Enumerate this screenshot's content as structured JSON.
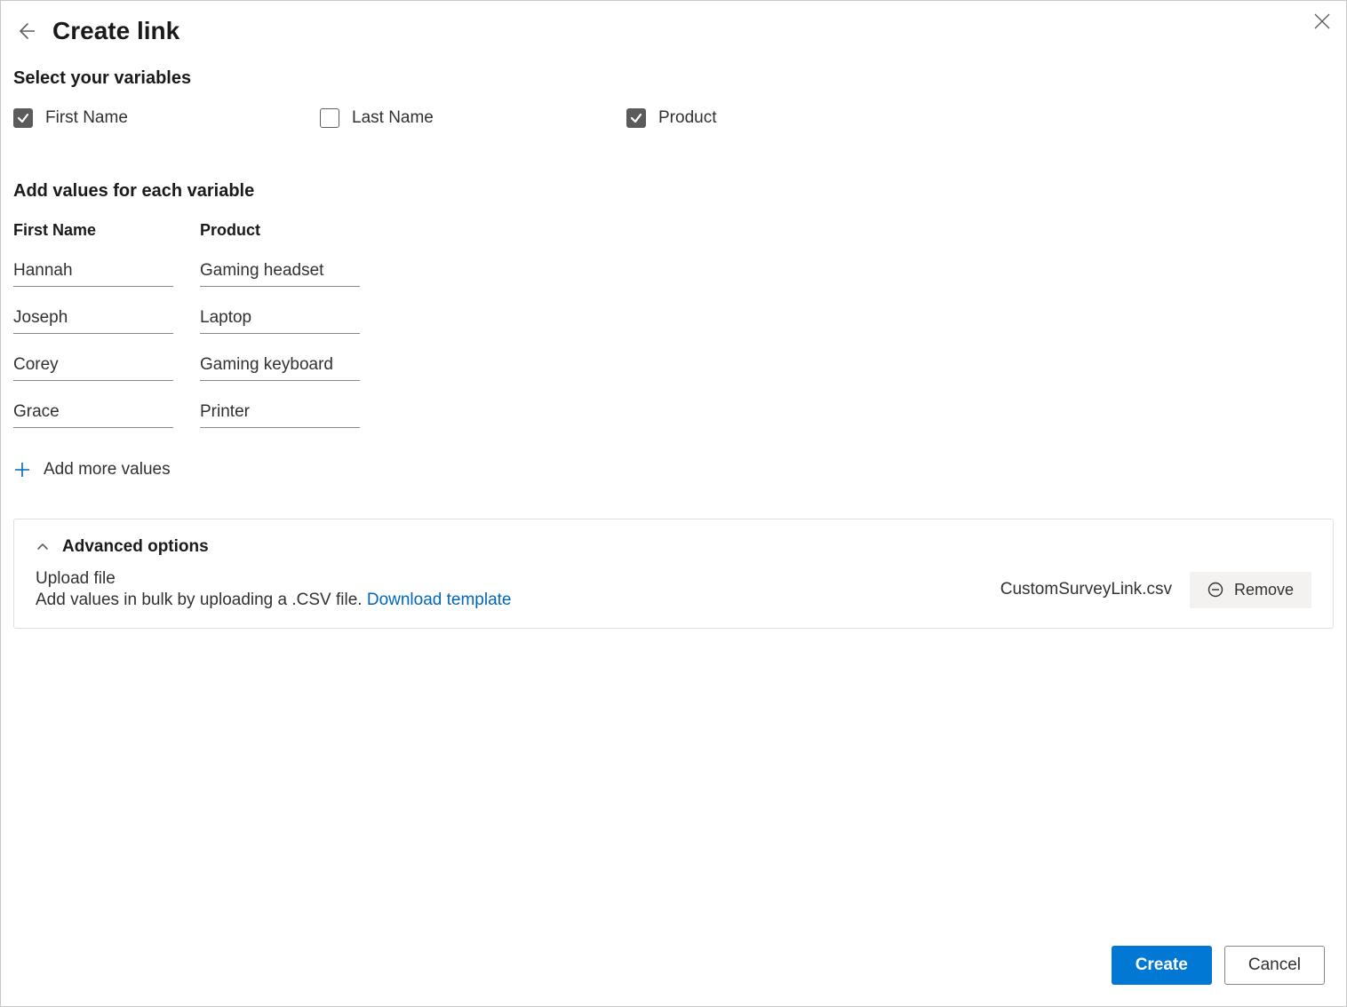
{
  "header": {
    "title": "Create link"
  },
  "sections": {
    "select_vars_heading": "Select your variables",
    "add_values_heading": "Add values for each variable"
  },
  "variables": [
    {
      "label": "First Name",
      "checked": true
    },
    {
      "label": "Last Name",
      "checked": false
    },
    {
      "label": "Product",
      "checked": true
    }
  ],
  "columns": [
    {
      "key": "first_name",
      "header": "First Name"
    },
    {
      "key": "product",
      "header": "Product"
    }
  ],
  "rows": [
    {
      "first_name": "Hannah",
      "product": "Gaming headset"
    },
    {
      "first_name": "Joseph",
      "product": "Laptop"
    },
    {
      "first_name": "Corey",
      "product": "Gaming keyboard"
    },
    {
      "first_name": "Grace",
      "product": "Printer"
    }
  ],
  "add_more_label": "Add more values",
  "advanced": {
    "title": "Advanced options",
    "upload_title": "Upload file",
    "upload_desc_prefix": "Add values in bulk by uploading a .CSV file. ",
    "download_link": "Download template",
    "filename": "CustomSurveyLink.csv",
    "remove_label": "Remove"
  },
  "footer": {
    "create": "Create",
    "cancel": "Cancel"
  }
}
